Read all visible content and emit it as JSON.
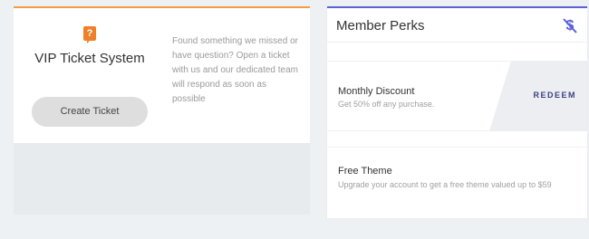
{
  "vip": {
    "icon": "help-icon",
    "title": "VIP Ticket System",
    "create_button": "Create Ticket",
    "description": "Found something we missed or have question? Open a ticket with us and our dedicated team will respond as soon as possible",
    "accent": "#f39c42"
  },
  "perks": {
    "title": "Member Perks",
    "header_icon": "dollar-off-icon",
    "accent": "#5b62d8",
    "items": [
      {
        "name": "Monthly Discount",
        "description": "Get 50% off any purchase.",
        "action": "REDEEM"
      },
      {
        "name": "Free Theme",
        "description": "Upgrade your account to get a free theme valued up to $59"
      }
    ]
  }
}
